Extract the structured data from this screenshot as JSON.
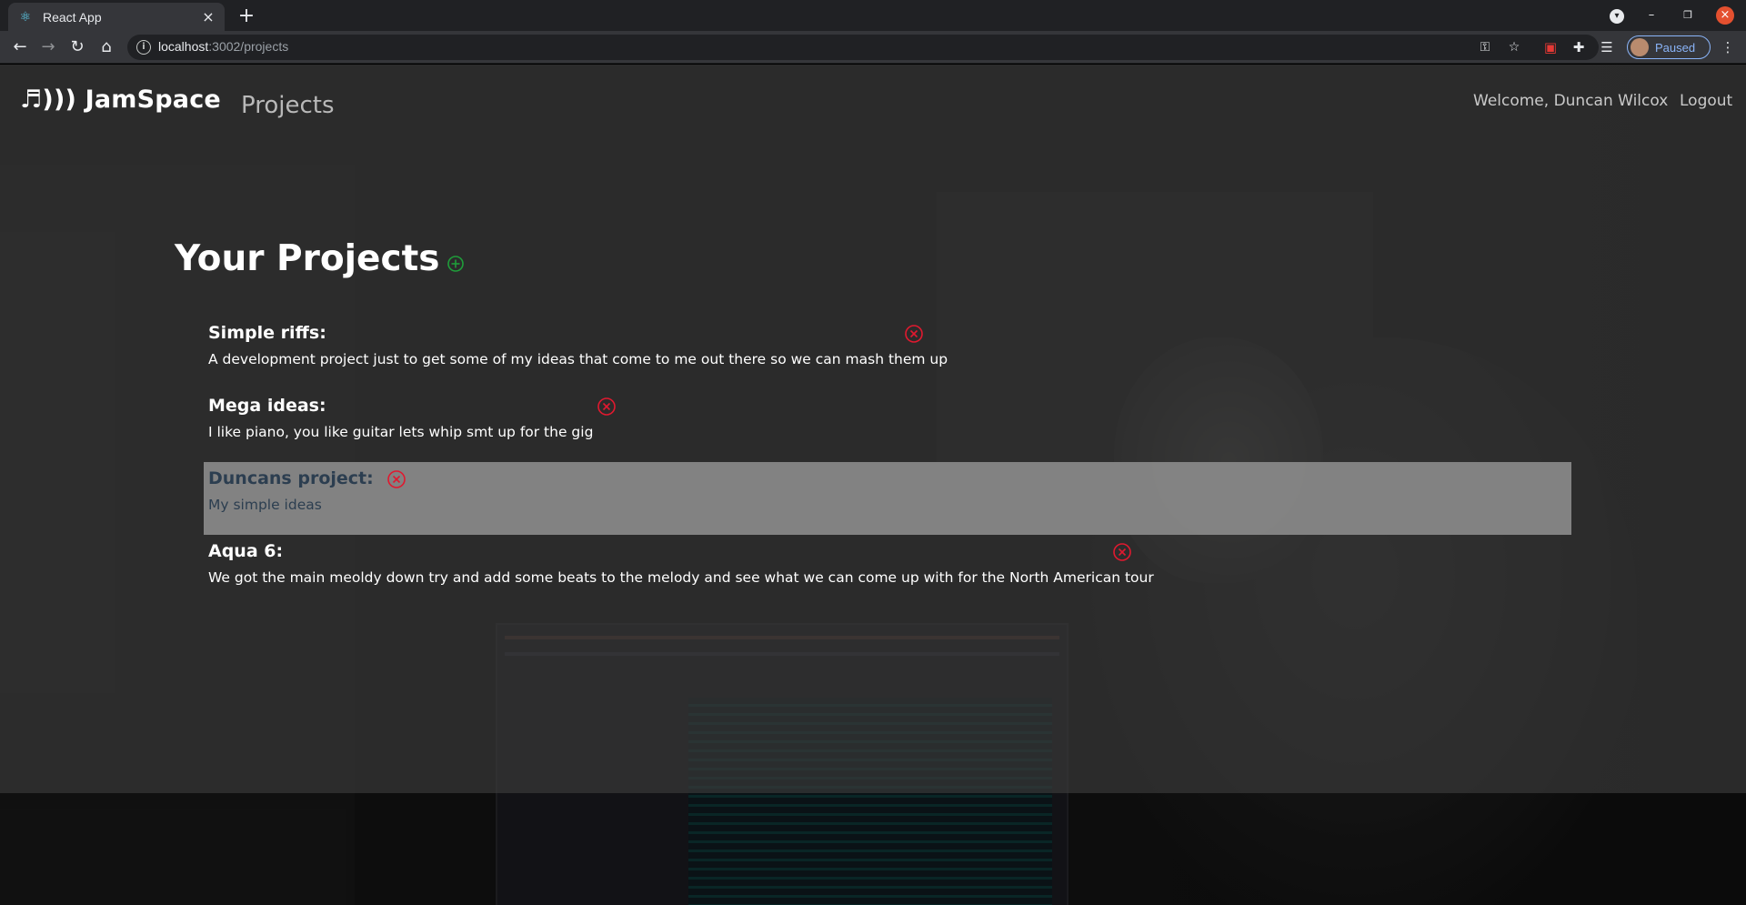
{
  "browser": {
    "tab_title": "React App",
    "url_host": "localhost",
    "url_path": ":3002/projects",
    "profile_status": "Paused"
  },
  "app": {
    "logo": "♬))) JamSpace",
    "nav_projects": "Projects",
    "welcome": "Welcome, Duncan Wilcox",
    "logout": "Logout"
  },
  "projects": {
    "heading": "Your Projects",
    "items": [
      {
        "name": "Simple riffs:",
        "description": "A development project just to get some of my ideas that come to me out there so we can mash them up"
      },
      {
        "name": "Mega ideas:",
        "description": "I like piano, you like guitar lets whip smt up for the gig"
      },
      {
        "name": "Duncans project:",
        "description": "My simple ideas"
      },
      {
        "name": "Aqua 6:",
        "description": "We got the main meoldy down try and add some beats to the melody and see what we can come up with for the North American tour"
      }
    ]
  },
  "colors": {
    "delete_icon": "#e0192f",
    "add_icon": "#1f9d3a",
    "selected_row_bg": "#8c8c8c",
    "selected_text": "#2c3e50"
  },
  "icons": [
    "react-favicon",
    "close-icon",
    "plus-icon",
    "back-arrow-icon",
    "forward-arrow-icon",
    "reload-icon",
    "home-icon",
    "info-icon",
    "key-icon",
    "star-icon",
    "extension-icon",
    "puzzle-icon",
    "reading-list-icon",
    "kebab-menu-icon",
    "add-circle-icon",
    "delete-circle-icon"
  ]
}
